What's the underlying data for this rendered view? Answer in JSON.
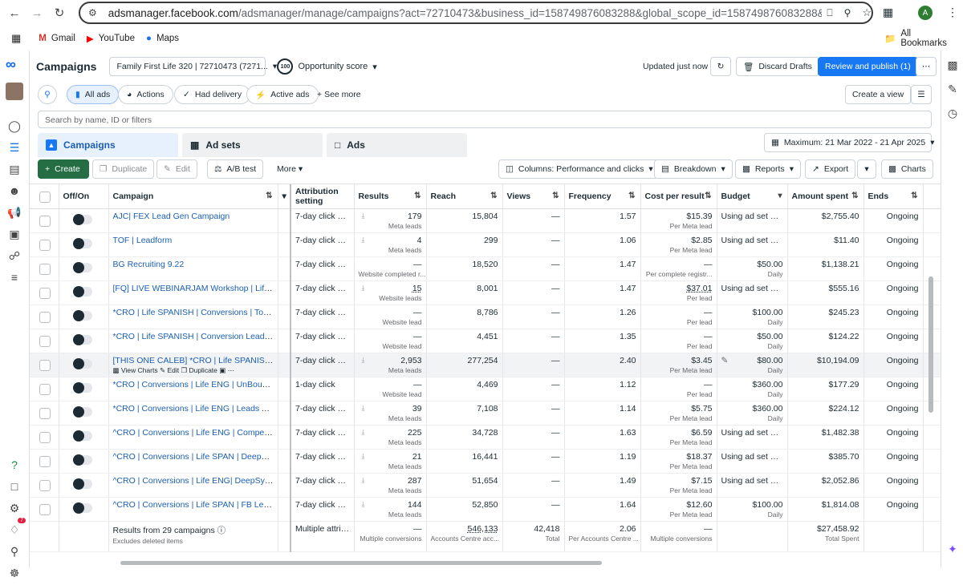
{
  "browser": {
    "url_domain": "adsmanager.facebook.com",
    "url_path": "/adsmanager/manage/campaigns?act=72710473&business_id=158749876083288&global_scope_id=158749876083288&nav_entry",
    "profile_initial": "A",
    "bookmarks": [
      {
        "label": "Gmail",
        "icon": "gmail-icon"
      },
      {
        "label": "YouTube",
        "icon": "youtube-icon"
      },
      {
        "label": "Maps",
        "icon": "maps-icon"
      }
    ],
    "all_bookmarks": "All Bookmarks"
  },
  "header": {
    "title": "Campaigns",
    "account": "Family First Life 320 | 72710473 (7271...",
    "opportunity_score_badge": "100",
    "opportunity_score": "Opportunity score",
    "updated": "Updated just now",
    "discard": "Discard Drafts",
    "publish": "Review and publish (1)"
  },
  "filters": {
    "all_ads": "All ads",
    "actions": "Actions",
    "had_delivery": "Had delivery",
    "active_ads": "Active ads",
    "see_more": "See more",
    "create_view": "Create a view",
    "search_placeholder": "Search by name, ID or filters"
  },
  "tabs": {
    "campaigns": "Campaigns",
    "adsets": "Ad sets",
    "ads": "Ads",
    "date_range": "Maximum: 21 Mar 2022 - 21 Apr 2025"
  },
  "toolbar": {
    "create": "Create",
    "duplicate": "Duplicate",
    "edit": "Edit",
    "ab_test": "A/B test",
    "more": "More",
    "columns": "Columns: Performance and clicks",
    "breakdown": "Breakdown",
    "reports": "Reports",
    "export": "Export",
    "charts": "Charts"
  },
  "columns": [
    "Off/On",
    "Campaign",
    "Attribution setting",
    "Results",
    "Reach",
    "Views",
    "Frequency",
    "Cost per result",
    "Budget",
    "Amount spent",
    "Ends"
  ],
  "rows": [
    {
      "campaign": "AJC| FEX Lead Gen Campaign",
      "attr": "7-day click or ...",
      "results": "179",
      "results_sub": "Meta leads",
      "reach": "15,804",
      "views": "—",
      "freq": "1.57",
      "cpr": "$15.39",
      "cpr_sub": "Per Meta lead",
      "budget": "Using ad set bu...",
      "budget_sub": "",
      "spent": "$2,755.40",
      "ends": "Ongoing"
    },
    {
      "campaign": "TOF | Leadform",
      "attr": "7-day click or ...",
      "results": "4",
      "results_sub": "Meta leads",
      "reach": "299",
      "views": "—",
      "freq": "1.06",
      "cpr": "$2.85",
      "cpr_sub": "Per Meta lead",
      "budget": "Using ad set bu...",
      "budget_sub": "",
      "spent": "$11.40",
      "ends": "Ongoing"
    },
    {
      "campaign": "BG Recruiting 9.22",
      "attr": "7-day click or ...",
      "results": "—",
      "results_sub": "Website completed r...",
      "reach": "18,520",
      "views": "—",
      "freq": "1.47",
      "cpr": "—",
      "cpr_sub": "Per complete registr...",
      "budget": "$50.00",
      "budget_sub": "Daily",
      "spent": "$1,138.21",
      "ends": "Ongoing"
    },
    {
      "campaign": "[FQ] LIVE WEBINARJAM Workshop | Life Insu...",
      "attr": "7-day click or ...",
      "results": "15",
      "results_sub": "Website leads",
      "reach": "8,001",
      "views": "—",
      "freq": "1.47",
      "cpr": "$37.01",
      "cpr_sub": "Per lead",
      "budget": "Using ad set bu...",
      "budget_sub": "",
      "spent": "$555.16",
      "ends": "Ongoing"
    },
    {
      "campaign": "*CRO | Life SPANISH | Conversions | To UnBo...",
      "attr": "7-day click or ...",
      "results": "—",
      "results_sub": "Website lead",
      "reach": "8,786",
      "views": "—",
      "freq": "1.26",
      "cpr": "—",
      "cpr_sub": "Per lead",
      "budget": "$100.00",
      "budget_sub": "Daily",
      "spent": "$245.23",
      "ends": "Ongoing"
    },
    {
      "campaign": "*CRO | Life SPANISH | Conversion Leads | FB...",
      "attr": "7-day click or ...",
      "results": "—",
      "results_sub": "Website lead",
      "reach": "4,451",
      "views": "—",
      "freq": "1.35",
      "cpr": "—",
      "cpr_sub": "Per lead",
      "budget": "$50.00",
      "budget_sub": "Daily",
      "spent": "$124.22",
      "ends": "Ongoing"
    },
    {
      "campaign": "[THIS ONE CALEB] *CRO | Life SPANISH | ...",
      "attr": "7-day click or ...",
      "results": "2,953",
      "results_sub": "Meta leads",
      "reach": "277,254",
      "views": "—",
      "freq": "2.40",
      "cpr": "$3.45",
      "cpr_sub": "Per Meta lead",
      "budget": "$80.00",
      "budget_sub": "Daily",
      "spent": "$10,194.09",
      "ends": "Ongoing",
      "highlight": true
    },
    {
      "campaign": "*CRO | Conversions | Life ENG | UnBounce/G...",
      "attr": "1-day click",
      "results": "—",
      "results_sub": "Website lead",
      "reach": "4,469",
      "views": "—",
      "freq": "1.12",
      "cpr": "—",
      "cpr_sub": "Per lead",
      "budget": "$360.00",
      "budget_sub": "Daily",
      "spent": "$177.29",
      "ends": "Ongoing"
    },
    {
      "campaign": "*CRO | Conversions | Life ENG | Leads Ad | B...",
      "attr": "7-day click or ...",
      "results": "39",
      "results_sub": "Meta leads",
      "reach": "7,108",
      "views": "—",
      "freq": "1.14",
      "cpr": "$5.75",
      "cpr_sub": "Per Meta lead",
      "budget": "$360.00",
      "budget_sub": "Daily",
      "spent": "$224.12",
      "ends": "Ongoing"
    },
    {
      "campaign": "^CRO | Conversions | Life ENG | Competitor ...",
      "attr": "7-day click or ...",
      "results": "225",
      "results_sub": "Meta leads",
      "reach": "34,728",
      "views": "—",
      "freq": "1.63",
      "cpr": "$6.59",
      "cpr_sub": "Per Meta lead",
      "budget": "Using ad set bu...",
      "budget_sub": "",
      "spent": "$1,482.38",
      "ends": "Ongoing"
    },
    {
      "campaign": "^CRO | Conversions | Life SPAN | DeepSync |...",
      "attr": "7-day click or ...",
      "results": "21",
      "results_sub": "Meta leads",
      "reach": "16,441",
      "views": "—",
      "freq": "1.19",
      "cpr": "$18.37",
      "cpr_sub": "Per Meta lead",
      "budget": "Using ad set bu...",
      "budget_sub": "",
      "spent": "$385.70",
      "ends": "Ongoing"
    },
    {
      "campaign": "^CRO | Conversions | Life ENG| DeepSync | F...",
      "attr": "7-day click or ...",
      "results": "287",
      "results_sub": "Meta leads",
      "reach": "51,654",
      "views": "—",
      "freq": "1.49",
      "cpr": "$7.15",
      "cpr_sub": "Per Meta lead",
      "budget": "Using ad set bu...",
      "budget_sub": "",
      "spent": "$2,052.86",
      "ends": "Ongoing"
    },
    {
      "campaign": "^CRO | Conversions | Life SPAN | FB Leads A...",
      "attr": "7-day click or ...",
      "results": "144",
      "results_sub": "Meta leads",
      "reach": "52,850",
      "views": "—",
      "freq": "1.64",
      "cpr": "$12.60",
      "cpr_sub": "Per Meta lead",
      "budget": "$100.00",
      "budget_sub": "Daily",
      "spent": "$1,814.08",
      "ends": "Ongoing"
    }
  ],
  "row_actions": {
    "view_charts": "View Charts",
    "edit": "Edit",
    "duplicate": "Duplicate"
  },
  "totals": {
    "label": "Results from 29 campaigns",
    "sub": "Excludes deleted items",
    "attr": "Multiple attrib...",
    "results": "—",
    "results_sub": "Multiple conversions",
    "reach": "546,133",
    "reach_sub": "Accounts Centre acc...",
    "views": "42,418",
    "views_sub": "Total",
    "freq": "2.06",
    "freq_sub": "Per Accounts Centre ...",
    "cpr": "—",
    "cpr_sub": "Multiple conversions",
    "spent": "$27,458.92",
    "spent_sub": "Total Spent"
  },
  "notifications_count": "7"
}
